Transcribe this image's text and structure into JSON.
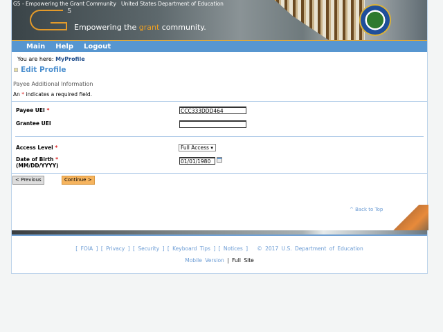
{
  "header": {
    "alt_logo": "G5 - Empowering the Grant Community",
    "alt_ed": "United States Department of Education",
    "logo_sup": "5",
    "tagline_pre": "Empowering the ",
    "tagline_hl": "grant",
    "tagline_post": " community."
  },
  "nav": [
    "Main",
    "Help",
    "Logout"
  ],
  "breadcrumb": {
    "label": "You are here: ",
    "current": "MyProfile"
  },
  "page_title": "Edit Profile",
  "section": "Payee Additional Information",
  "required_note": {
    "pre": "An ",
    "star": "*",
    "post": " indicates a required field."
  },
  "form": {
    "payee_uei": {
      "label": "Payee UEI",
      "value": "CCC333DDD464"
    },
    "grantee_uei": {
      "label": "Grantee UEI",
      "value": ""
    },
    "access_level": {
      "label": "Access Level",
      "value": "Full Access"
    },
    "dob": {
      "label": "Date of Birth",
      "format": "(MM/DD/YYYY)",
      "value": "01/01/1980"
    }
  },
  "buttons": {
    "previous": "< Previous",
    "continue": "Continue >"
  },
  "back_to_top": "^ Back to Top",
  "footer": {
    "links": "[ FOIA ] [ Privacy ] [ Security ] [ Keyboard Tips ] [ Notices ]",
    "copyright": "© 2017 U.S. Department of Education",
    "mobile": "Mobile Version",
    "sep": "|",
    "full": "Full Site"
  },
  "colors": {
    "nav": "#5796d0",
    "accent": "#f0a020",
    "link": "#6a9bd4"
  }
}
